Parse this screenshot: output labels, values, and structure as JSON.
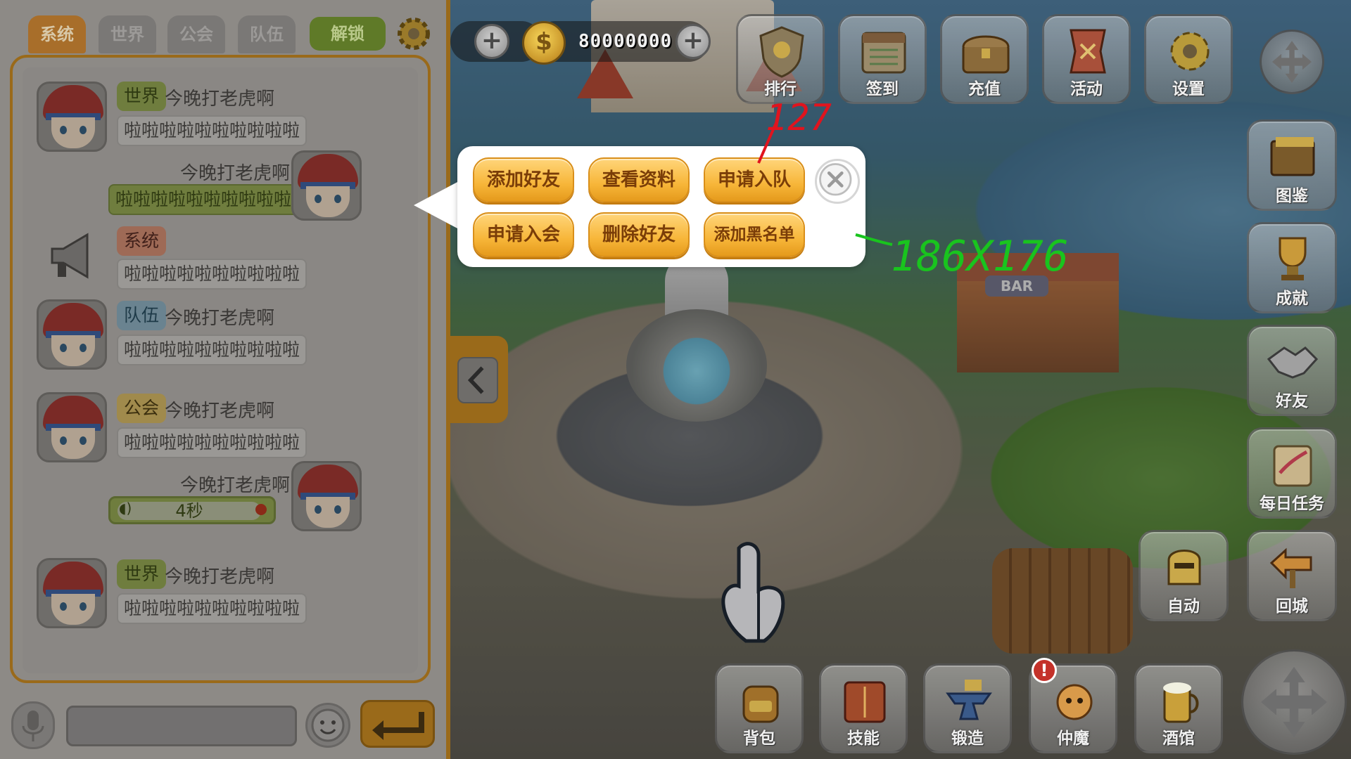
{
  "chat": {
    "tabs": [
      {
        "label": "系统",
        "active": true
      },
      {
        "label": "世界",
        "active": false
      },
      {
        "label": "公会",
        "active": false
      },
      {
        "label": "队伍",
        "active": false
      }
    ],
    "unlock_label": "解锁",
    "messages": [
      {
        "side": "left",
        "channel": "世界",
        "name": "今晚打老虎啊",
        "text": "啦啦啦啦啦啦啦啦啦啦"
      },
      {
        "side": "right",
        "name": "今晚打老虎啊",
        "text": "啦啦啦啦啦啦啦啦啦啦"
      },
      {
        "side": "left",
        "channel": "系统",
        "text": "啦啦啦啦啦啦啦啦啦啦"
      },
      {
        "side": "left",
        "channel": "队伍",
        "name": "今晚打老虎啊",
        "text": "啦啦啦啦啦啦啦啦啦啦"
      },
      {
        "side": "left",
        "channel": "公会",
        "name": "今晚打老虎啊",
        "text": "啦啦啦啦啦啦啦啦啦啦"
      },
      {
        "side": "right",
        "name": "今晚打老虎啊",
        "voice_duration": "4秒"
      },
      {
        "side": "left",
        "channel": "世界",
        "name": "今晚打老虎啊",
        "text": "啦啦啦啦啦啦啦啦啦啦"
      }
    ]
  },
  "hud": {
    "gold_amount": "80000000",
    "coin_symbol": "$",
    "top_menu": [
      {
        "label": "排行",
        "icon": "shield-icon"
      },
      {
        "label": "签到",
        "icon": "calendar-icon"
      },
      {
        "label": "充值",
        "icon": "treasure-chest-icon"
      },
      {
        "label": "活动",
        "icon": "banner-icon"
      },
      {
        "label": "设置",
        "icon": "gear-icon"
      }
    ],
    "right_menu": [
      {
        "label": "图鉴",
        "icon": "book-icon"
      },
      {
        "label": "成就",
        "icon": "trophy-icon"
      },
      {
        "label": "好友",
        "icon": "handshake-icon"
      },
      {
        "label": "每日任务",
        "icon": "scroll-icon"
      },
      {
        "label": "回城",
        "icon": "return-sign-icon"
      }
    ],
    "auto_label": "自动",
    "bottom_menu": [
      {
        "label": "背包",
        "icon": "backpack-icon"
      },
      {
        "label": "技能",
        "icon": "spellbook-icon"
      },
      {
        "label": "锻造",
        "icon": "anvil-icon"
      },
      {
        "label": "仲魔",
        "icon": "dragon-pet-icon"
      },
      {
        "label": "酒馆",
        "icon": "beer-mug-icon"
      }
    ],
    "bar_sign": "BAR"
  },
  "popup": {
    "buttons_row1": [
      "添加好友",
      "查看资料",
      "申请入队"
    ],
    "buttons_row2": [
      "申请入会",
      "删除好友",
      "添加黑名单"
    ],
    "close_icon": "close-icon"
  },
  "annotations": {
    "button_height_mark": "127",
    "popup_size_mark": "186X176"
  },
  "colors": {
    "popup_button": "#f7b639",
    "popup_button_text": "#7a3d08",
    "annotation_red": "#e0141e",
    "annotation_green": "#19c41e",
    "panel_border": "#9a6a1a"
  }
}
